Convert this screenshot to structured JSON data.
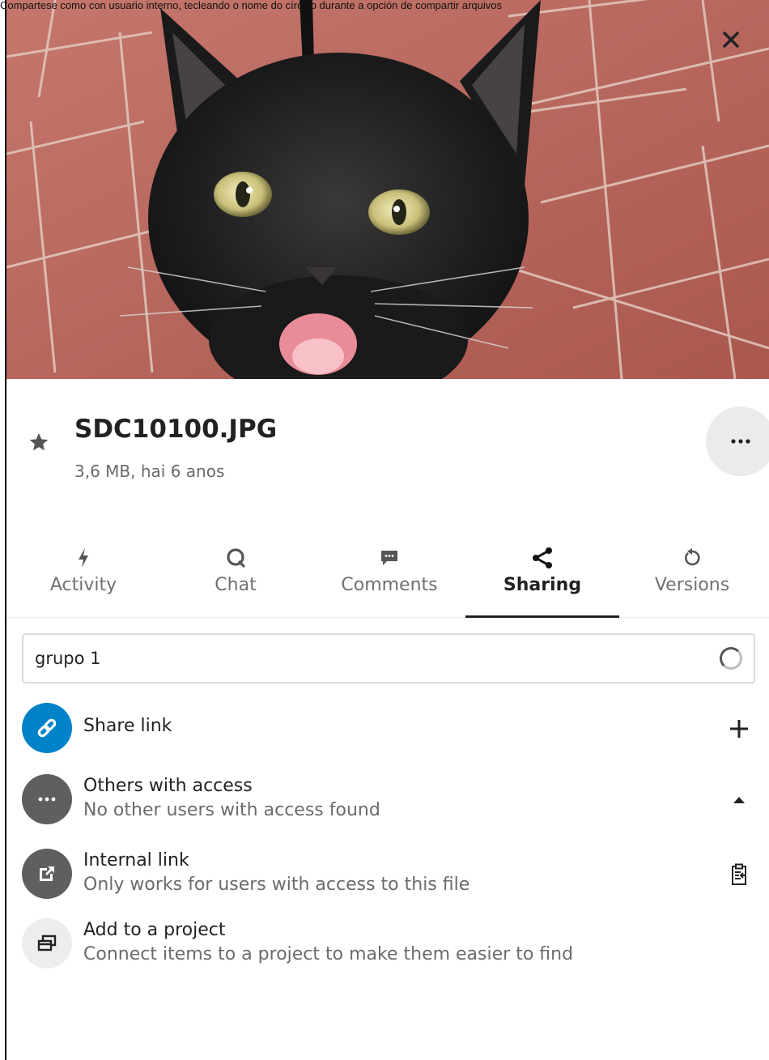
{
  "caption": "Compartese como con usuario interno, tecleando o nome do círculo durante a opción de compartir arquivos",
  "file": {
    "name": "SDC10100.JPG",
    "info": "3,6 MB, hai 6 anos"
  },
  "tabs": [
    {
      "label": "Activity",
      "icon": "flash-icon"
    },
    {
      "label": "Chat",
      "icon": "chat-icon"
    },
    {
      "label": "Comments",
      "icon": "comment-icon"
    },
    {
      "label": "Sharing",
      "icon": "share-icon"
    },
    {
      "label": "Versions",
      "icon": "history-icon"
    }
  ],
  "active_tab": "Sharing",
  "search": {
    "value": "grupo 1"
  },
  "sharing": {
    "share_link": {
      "title": "Share link"
    },
    "others": {
      "title": "Others with access",
      "subtitle": "No other users with access found"
    },
    "internal": {
      "title": "Internal link",
      "subtitle": "Only works for users with access to this file"
    },
    "project": {
      "title": "Add to a project",
      "subtitle": "Connect items to a project to make them easier to find"
    }
  },
  "colors": {
    "accent": "#0082c9",
    "avatar_dark": "#5f5f5f",
    "avatar_light": "#ededed",
    "active_tab": "#222222"
  }
}
